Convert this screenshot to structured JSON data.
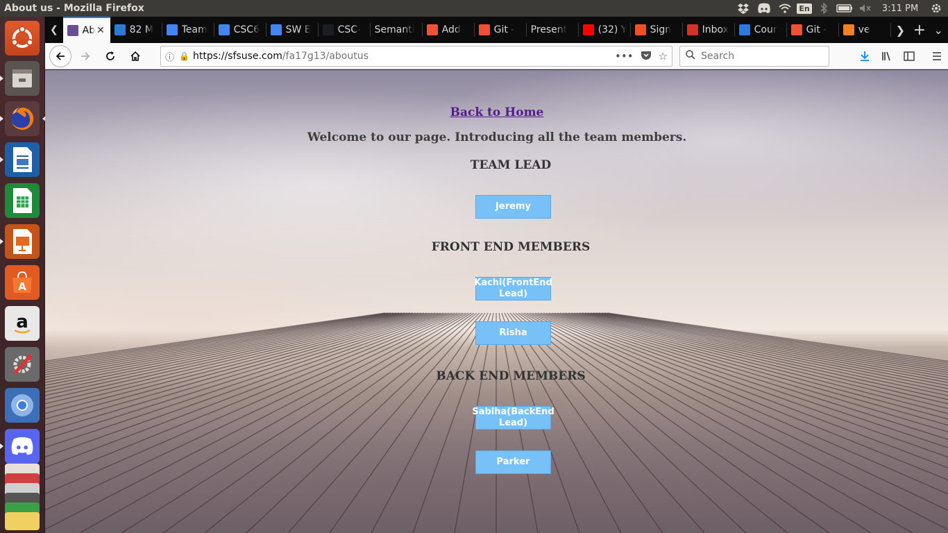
{
  "system": {
    "window_title": "About us - Mozilla Firefox",
    "keyboard_layout": "En",
    "clock": "3:11 PM"
  },
  "launcher": {
    "items": [
      {
        "name": "ubuntu-dash-icon"
      },
      {
        "name": "files-icon"
      },
      {
        "name": "firefox-icon"
      },
      {
        "name": "libreoffice-writer-icon"
      },
      {
        "name": "libreoffice-calc-icon"
      },
      {
        "name": "libreoffice-impress-icon"
      },
      {
        "name": "ubuntu-software-icon"
      },
      {
        "name": "amazon-icon"
      },
      {
        "name": "system-settings-icon"
      },
      {
        "name": "chromium-icon"
      },
      {
        "name": "discord-icon"
      }
    ]
  },
  "browser": {
    "tabs": [
      {
        "label": "Ab",
        "icon": "sfsu-icon",
        "color": "#6a4c93",
        "active": true
      },
      {
        "label": "82 M",
        "icon": "board-icon",
        "color": "#2e7bd6"
      },
      {
        "label": "Team",
        "icon": "docs-icon",
        "color": "#4285f4"
      },
      {
        "label": "CSC6",
        "icon": "docs-icon",
        "color": "#4285f4"
      },
      {
        "label": "SW E",
        "icon": "docs-icon",
        "color": "#4285f4"
      },
      {
        "label": "CSC-",
        "icon": "github-icon",
        "color": "#1b1f23"
      },
      {
        "label": "Semanti",
        "icon": "",
        "color": ""
      },
      {
        "label": "Add",
        "icon": "git-icon",
        "color": "#f05033"
      },
      {
        "label": "Git - ",
        "icon": "git-icon",
        "color": "#f05033"
      },
      {
        "label": "Present",
        "icon": "",
        "color": ""
      },
      {
        "label": "(32) Y",
        "icon": "youtube-icon",
        "color": "#ff0000"
      },
      {
        "label": "Sign",
        "icon": "microsoft-icon",
        "color": "#f25022"
      },
      {
        "label": "Inbox",
        "icon": "gmail-icon",
        "color": "#d93025"
      },
      {
        "label": "Cour",
        "icon": "info-icon",
        "color": "#2a7ae2"
      },
      {
        "label": "Git - ",
        "icon": "git-icon",
        "color": "#f05033"
      },
      {
        "label": "ve",
        "icon": "stackoverflow-icon",
        "color": "#f48024"
      }
    ],
    "url_host": "https://sfsuse.com",
    "url_path": "/fa17g13/aboutus",
    "search_placeholder": "Search"
  },
  "page": {
    "back_link": "Back to Home",
    "welcome": "Welcome to our page. Introducing all the team members.",
    "team_lead_heading": "TEAM LEAD",
    "team_lead": [
      "Jeremy"
    ],
    "front_end_heading": "FRONT END MEMBERS",
    "front_end": [
      "Kachi(FrontEnd Lead)",
      "Risha"
    ],
    "back_end_heading": "BACK END MEMBERS",
    "back_end": [
      "Sabiha(BackEnd Lead)",
      "Parker"
    ]
  }
}
